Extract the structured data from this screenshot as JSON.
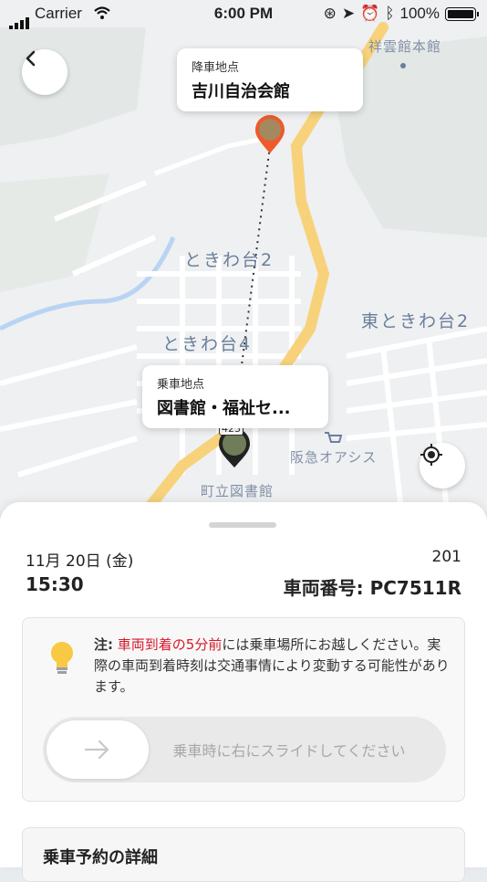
{
  "status_bar": {
    "carrier": "Carrier",
    "time": "6:00 PM",
    "battery": "100%"
  },
  "map": {
    "labels": {
      "top_right": "祥雲館本館",
      "tokiwadai2": "ときわ台2",
      "tokiwadai4": "ときわ台4",
      "higashi_tokiwadai2": "東ときわ台2",
      "hankyu": "阪急オアシス",
      "library": "町立図書館",
      "road_no": "423"
    },
    "dropoff": {
      "label": "降車地点",
      "place": "吉川自治会館"
    },
    "pickup": {
      "label": "乗車地点",
      "place": "図書館・福祉セ..."
    },
    "route_color": "#333333",
    "road_color": "#f7d27a"
  },
  "booking": {
    "date": "11月 20日 (金)",
    "route_no": "201",
    "time": "15:30",
    "vehicle": "車両番号: PC7511R"
  },
  "notice": {
    "prefix": "注:",
    "highlight": "車両到着の5分前",
    "rest": "には乗車場所にお越しください。実際の車両到着時刻は交通事情により変動する可能性があります。",
    "slider_label": "乗車時に右にスライドしてください"
  },
  "details": {
    "title": "乗車予約の詳細"
  },
  "colors": {
    "accent_red": "#d6192c",
    "pin_orange": "#ee5a2a",
    "bulb_yellow": "#f8c943"
  }
}
